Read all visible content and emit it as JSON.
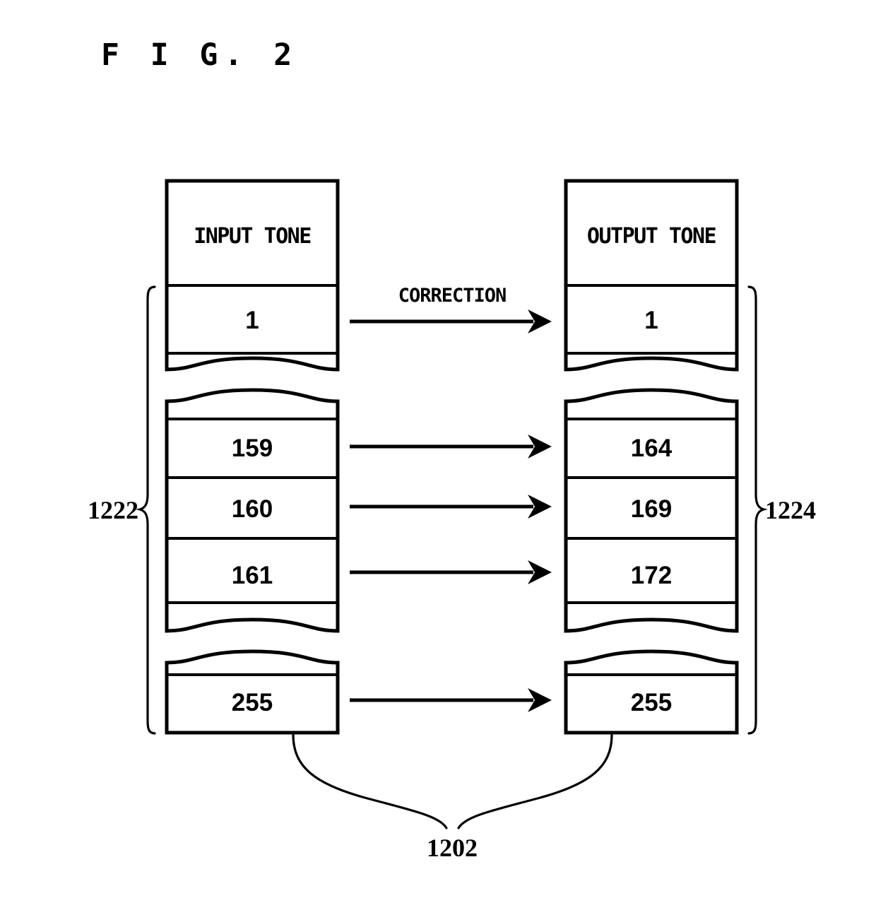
{
  "figure": {
    "title": "F I G.  2",
    "flow_label": "CORRECTION"
  },
  "tables": {
    "input": {
      "header": "INPUT TONE",
      "reference_numeral": "1222"
    },
    "output": {
      "header": "OUTPUT TONE",
      "reference_numeral": "1224"
    }
  },
  "mapping": {
    "reference_numeral": "1202",
    "rows": [
      {
        "input": "1",
        "output": "1"
      },
      {
        "input": "159",
        "output": "164"
      },
      {
        "input": "160",
        "output": "169"
      },
      {
        "input": "161",
        "output": "172"
      },
      {
        "input": "255",
        "output": "255"
      }
    ]
  }
}
